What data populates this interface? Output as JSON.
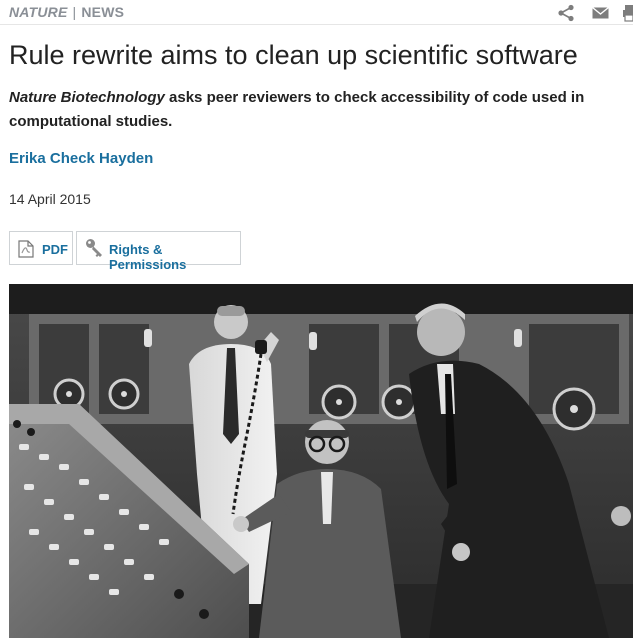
{
  "breadcrumb": {
    "journal": "NATURE",
    "section": "NEWS"
  },
  "header_icons": [
    "share-icon",
    "email-icon",
    "print-icon"
  ],
  "article": {
    "title": "Rule rewrite aims to clean up scientific software",
    "standfirst_italic": "Nature Biotechnology",
    "standfirst_rest": " asks peer reviewers to check accessibility of code used in computational studies.",
    "author": "Erika Check Hayden",
    "date": "14 April 2015"
  },
  "actions": {
    "pdf_label": "PDF",
    "rights_label": "Rights & Permissions"
  },
  "colors": {
    "link": "#1a6f9e",
    "muted": "#8a8f96",
    "text": "#222222"
  }
}
